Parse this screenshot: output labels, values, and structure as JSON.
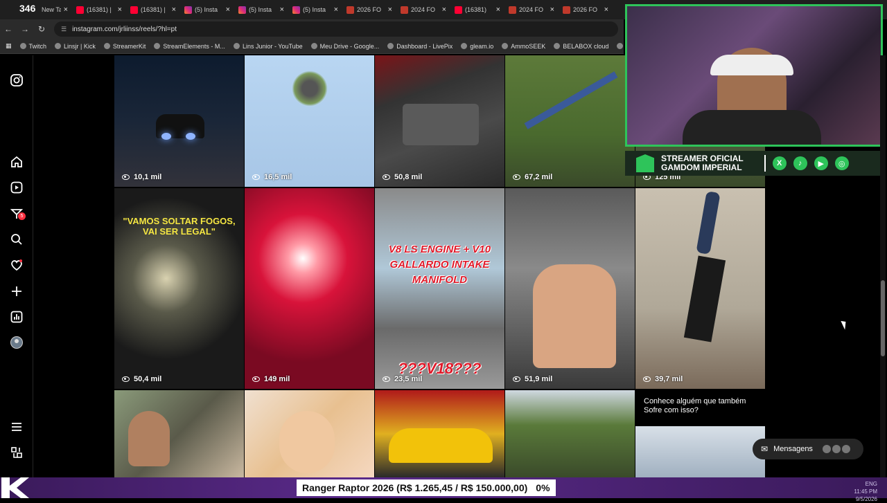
{
  "browser": {
    "counter": "346",
    "tabs": [
      {
        "label": "New Tab",
        "icon": "kick-favicon"
      },
      {
        "label": "(16381) |",
        "icon": "youtube-favicon"
      },
      {
        "label": "(16381) |",
        "icon": "youtube-favicon"
      },
      {
        "label": "(5) Insta",
        "icon": "instagram-favicon"
      },
      {
        "label": "(5) Insta",
        "icon": "instagram-favicon"
      },
      {
        "label": "(5) Insta",
        "icon": "instagram-favicon"
      },
      {
        "label": "2026 FO",
        "icon": "ammo-favicon"
      },
      {
        "label": "2024 FO",
        "icon": "ammo-favicon"
      },
      {
        "label": "(16381)",
        "icon": "youtube-favicon"
      },
      {
        "label": "2024 FO",
        "icon": "ammo-favicon"
      },
      {
        "label": "2026 FO",
        "icon": "ammo-favicon"
      }
    ],
    "url": "instagram.com/jrliinss/reels/?hl=pt",
    "bookmarks": [
      "Twitch",
      "Linsjr | Kick",
      "StreamerKit",
      "StreamElements - M...",
      "Lins Junior - YouTube",
      "Meu Drive - Google...",
      "Dashboard - LivePix",
      "gleam.io",
      "AmmoSEEK",
      "BELABOX cloud",
      "Nightbot - Comm"
    ]
  },
  "sidebar": {
    "notification_count": "5",
    "icons": [
      "instagram-icon",
      "home-icon",
      "reels-icon",
      "messages-icon",
      "search-icon",
      "notifications-icon",
      "create-icon",
      "insights-icon",
      "profile-icon",
      "more-icon",
      "threads-icon"
    ]
  },
  "reels": [
    {
      "views": "10,1 mil",
      "caption": ""
    },
    {
      "views": "16,5 mil",
      "caption": ""
    },
    {
      "views": "50,8 mil",
      "caption": ""
    },
    {
      "views": "67,2 mil",
      "caption": ""
    },
    {
      "views": "125 mil",
      "caption": ""
    },
    {
      "views": "50,4 mil",
      "caption": "\"VAMOS SOLTAR FOGOS, VAI SER LEGAL\""
    },
    {
      "views": "149 mil",
      "caption": ""
    },
    {
      "views": "23,5 mil",
      "caption": "V8 LS ENGINE + V10 GALLARDO INTAKE MANIFOLD",
      "caption2": "???V18???"
    },
    {
      "views": "51,9 mil",
      "caption": ""
    },
    {
      "views": "39,7 mil",
      "caption": ""
    },
    {
      "views": "",
      "caption": ""
    },
    {
      "views": "",
      "caption": ""
    },
    {
      "views": "",
      "caption": ""
    },
    {
      "views": "",
      "caption": ""
    },
    {
      "views": "",
      "caption": "Conhece alguém que também Sofre com isso?"
    }
  ],
  "overlay": {
    "banner_line1": "STREAMER OFICIAL",
    "banner_line2": "GAMDOM IMPERIAL",
    "social": [
      "X",
      "♪",
      "▶",
      "◎"
    ]
  },
  "messages": {
    "label": "Mensagens",
    "count": "5"
  },
  "goal": {
    "label": "Ranger Raptor 2026 (R$ 1.265,45 / R$ 150.000,00)",
    "percent": "0%"
  },
  "system": {
    "lang": "ENG",
    "time": "11:45 PM",
    "date": "9/5/2026"
  }
}
